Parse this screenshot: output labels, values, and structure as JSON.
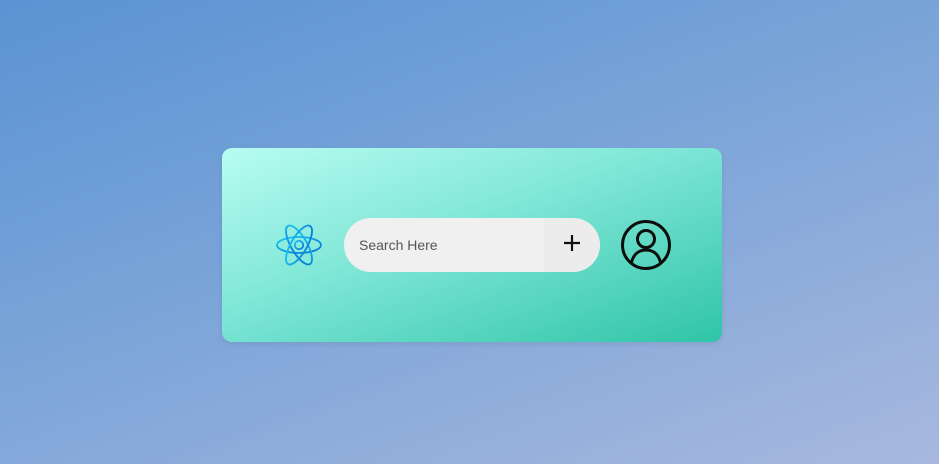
{
  "search": {
    "placeholder": "Search Here",
    "value": ""
  },
  "icons": {
    "logo": "atom-icon",
    "add": "plus-icon",
    "profile": "user-circle-icon"
  },
  "colors": {
    "logo_stroke": "#0a8fe0",
    "card_start": "#b8fcf2",
    "card_end": "#2fc4a8"
  }
}
